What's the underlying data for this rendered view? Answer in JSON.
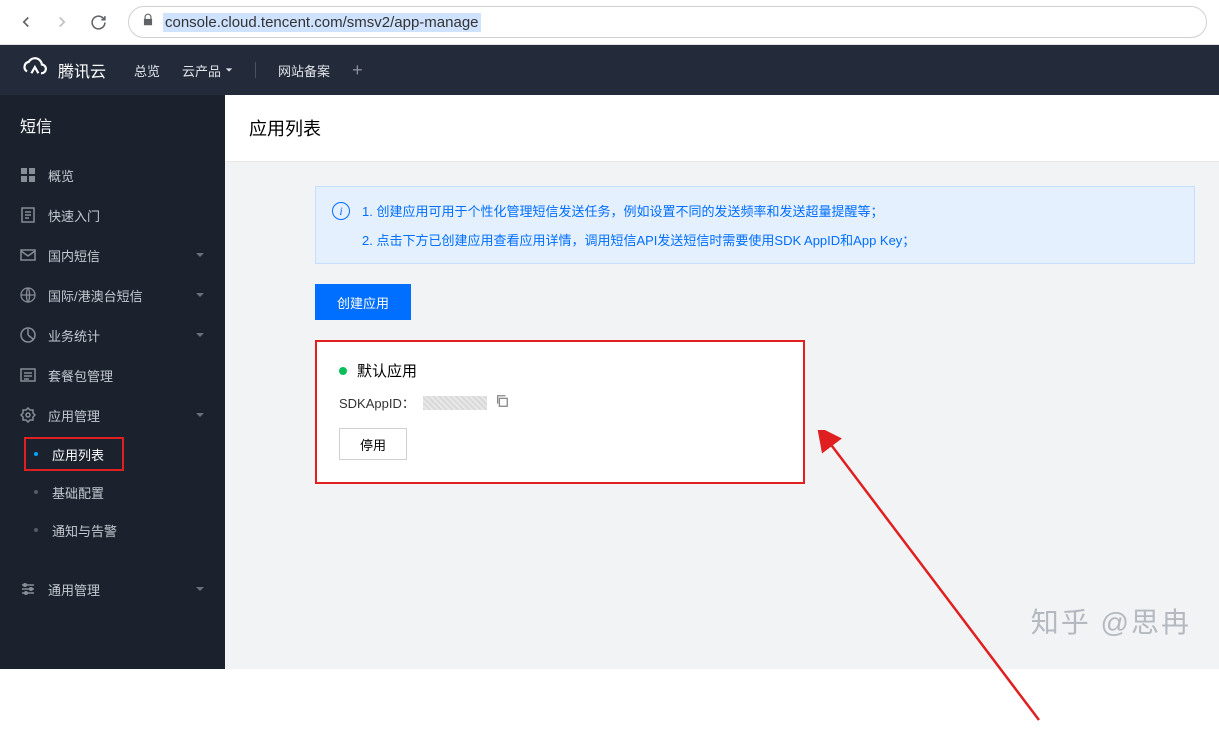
{
  "browser": {
    "url": "console.cloud.tencent.com/smsv2/app-manage"
  },
  "header": {
    "brand": "腾讯云",
    "nav": {
      "overview": "总览",
      "products": "云产品",
      "beian": "网站备案"
    }
  },
  "sidebar": {
    "title": "短信",
    "items": [
      {
        "label": "概览",
        "icon": "grid"
      },
      {
        "label": "快速入门",
        "icon": "doc"
      },
      {
        "label": "国内短信",
        "icon": "mail",
        "expandable": true
      },
      {
        "label": "国际/港澳台短信",
        "icon": "globe",
        "expandable": true
      },
      {
        "label": "业务统计",
        "icon": "chart",
        "expandable": true
      },
      {
        "label": "套餐包管理",
        "icon": "list"
      },
      {
        "label": "应用管理",
        "icon": "gear",
        "expandable": true,
        "expanded": true
      },
      {
        "label": "通用管理",
        "icon": "sliders",
        "expandable": true
      }
    ],
    "sub": {
      "app_list": "应用列表",
      "basic_config": "基础配置",
      "alerts": "通知与告警"
    }
  },
  "page": {
    "title": "应用列表",
    "info": {
      "line1": "1. 创建应用可用于个性化管理短信发送任务，例如设置不同的发送频率和发送超量提醒等；",
      "line2": "2. 点击下方已创建应用查看应用详情，调用短信API发送短信时需要使用SDK AppID和App Key；"
    },
    "create_btn": "创建应用",
    "app_card": {
      "name": "默认应用",
      "sdk_label": "SDKAppID：",
      "disable_btn": "停用"
    }
  },
  "watermark": "知乎 @思冉"
}
